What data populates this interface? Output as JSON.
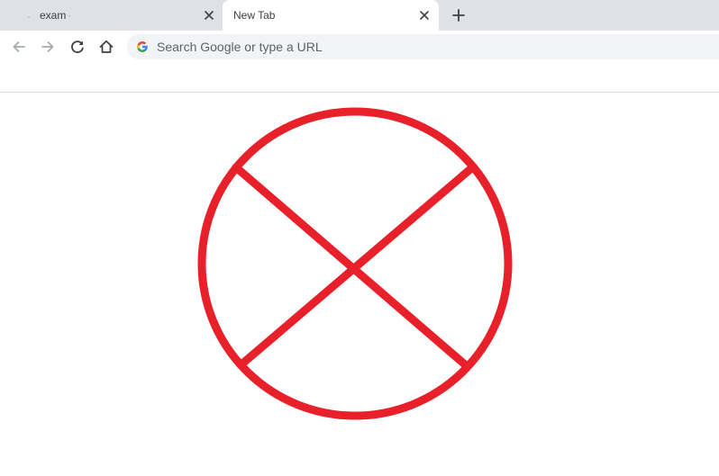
{
  "tabs": [
    {
      "title": "exam",
      "title_tail": "·",
      "active": false,
      "close_icon": "close-icon"
    },
    {
      "title": "New Tab",
      "active": true,
      "close_icon": "close-icon"
    }
  ],
  "new_tab_icon": "plus-icon",
  "toolbar": {
    "back_icon": "arrow-left-icon",
    "forward_icon": "arrow-right-icon",
    "reload_icon": "reload-icon",
    "home_icon": "home-icon"
  },
  "omnibox": {
    "placeholder": "Search Google or type a URL",
    "icon": "google-g-icon"
  },
  "content": {
    "symbol": "circled-x-icon",
    "symbol_color": "#e8202a"
  },
  "colors": {
    "tabstrip": "#dee1e6",
    "omnibox": "#f1f3f4",
    "text": "#3c4043",
    "placeholder": "#5f6368"
  }
}
